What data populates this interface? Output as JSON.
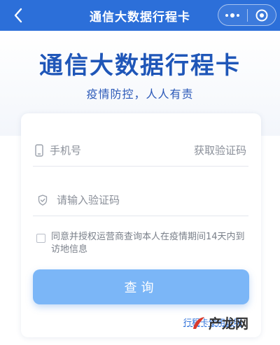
{
  "navbar": {
    "title": "通信大数据行程卡",
    "back_icon": "chevron-left-icon",
    "more_icon": "more-dots-icon",
    "close_icon": "target-circle-icon",
    "bg_color": "#2c6fd9"
  },
  "hero": {
    "title": "通信大数据行程卡",
    "subtitle": "疫情防控，人人有责"
  },
  "form": {
    "phone_placeholder": "手机号",
    "get_code_label": "获取验证码",
    "code_placeholder": "请输入验证码",
    "phone_icon": "phone-icon",
    "shield_icon": "shield-icon",
    "agreement_text": "同意并授权运营商查询本人在疫情期间14天内到访地信息",
    "submit_label": "查询",
    "submit_color": "#7bb6f7"
  },
  "footer": {
    "link_text": "行程卡使用说明",
    "watermark_text": "产龙网"
  }
}
